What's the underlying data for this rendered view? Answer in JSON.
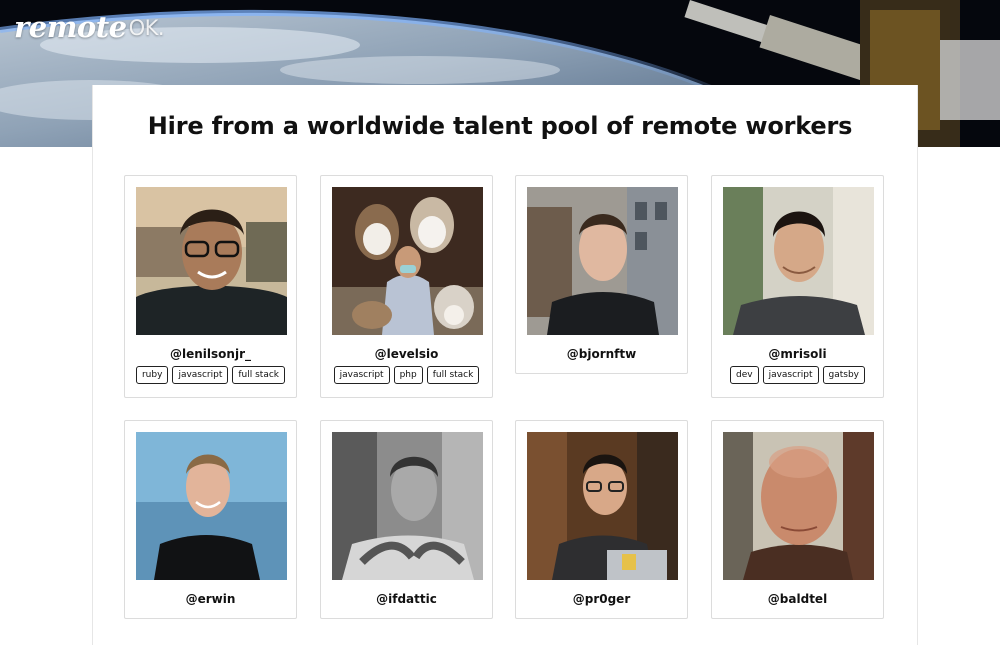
{
  "brand": {
    "logo_text": "remote",
    "logo_suffix": "OK."
  },
  "headline": "Hire from a worldwide talent pool of remote workers",
  "profiles": [
    {
      "handle": "@lenilsonjr_",
      "tags": [
        "ruby",
        "javascript",
        "full stack"
      ]
    },
    {
      "handle": "@levelsio",
      "tags": [
        "javascript",
        "php",
        "full stack"
      ]
    },
    {
      "handle": "@bjornftw",
      "tags": []
    },
    {
      "handle": "@mrisoli",
      "tags": [
        "dev",
        "javascript",
        "gatsby"
      ]
    },
    {
      "handle": "@erwin",
      "tags": []
    },
    {
      "handle": "@ifdattic",
      "tags": []
    },
    {
      "handle": "@pr0ger",
      "tags": []
    },
    {
      "handle": "@baldtel",
      "tags": []
    }
  ],
  "colors": {
    "text": "#111111",
    "card_border": "#dcdcdc",
    "panel_bg": "#ffffff",
    "hero_space": "#05070d"
  }
}
